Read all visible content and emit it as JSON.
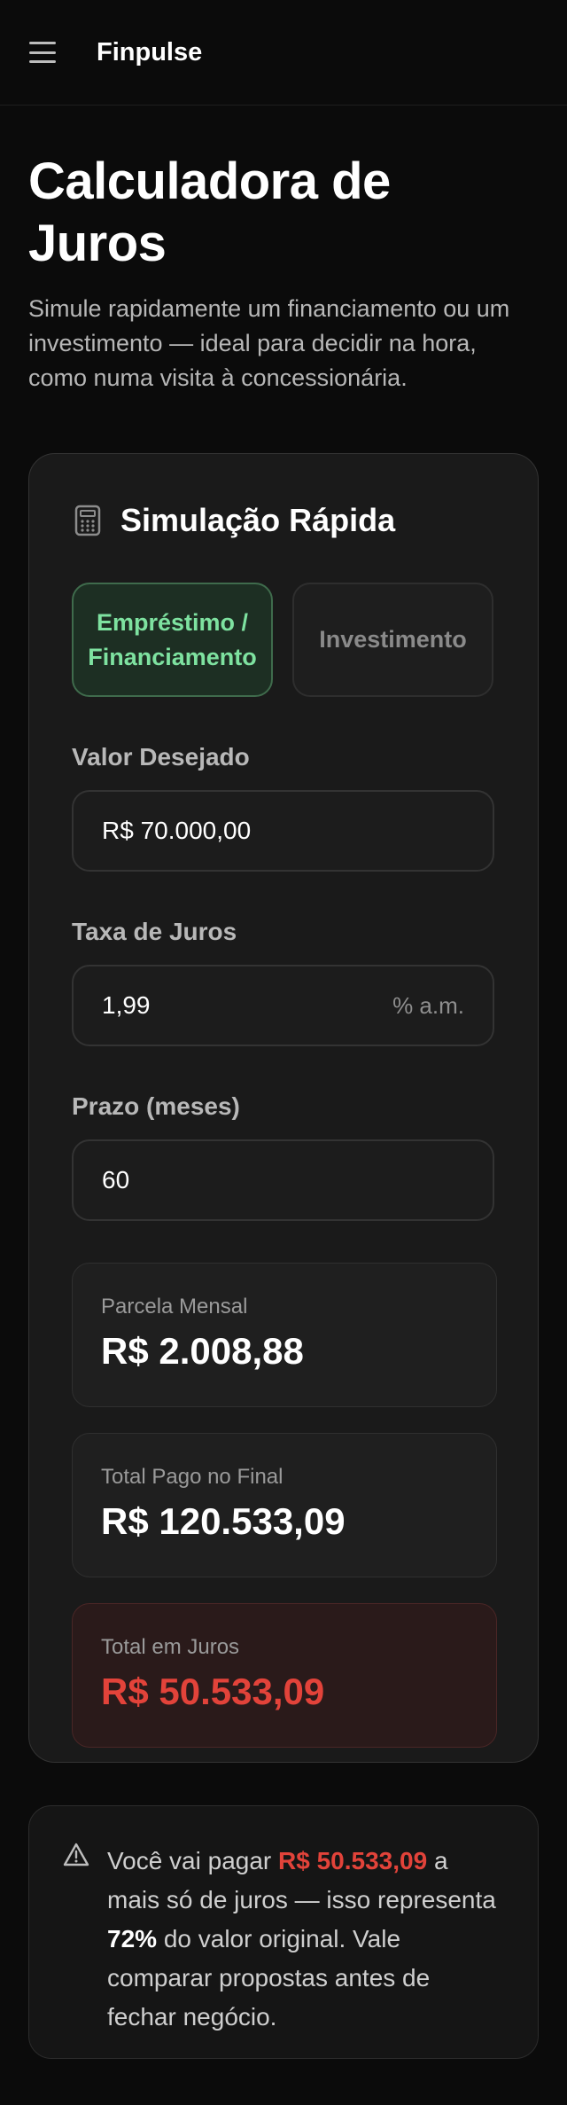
{
  "header": {
    "menu_icon": "hamburger-menu-icon",
    "brand": "Finpulse"
  },
  "page": {
    "title": "Calculadora de Juros",
    "subtitle": "Simule rapidamente um financiamento ou um investimento — ideal para decidir na hora, como numa visita à concessionária."
  },
  "card": {
    "icon": "calculator-icon",
    "title": "Simulação Rápida",
    "tabs": [
      {
        "label": "Empréstimo / Financiamento",
        "active": true
      },
      {
        "label": "Investimento",
        "active": false
      }
    ],
    "fields": {
      "amount": {
        "label": "Valor Desejado",
        "value": "R$ 70.000,00"
      },
      "rate": {
        "label": "Taxa de Juros",
        "value": "1,99",
        "suffix": "% a.m."
      },
      "term": {
        "label": "Prazo (meses)",
        "value": "60"
      }
    },
    "results": {
      "monthly": {
        "label": "Parcela Mensal",
        "value": "R$ 2.008,88"
      },
      "total": {
        "label": "Total Pago no Final",
        "value": "R$ 120.533,09"
      },
      "interest": {
        "label": "Total em Juros",
        "value": "R$ 50.533,09"
      }
    }
  },
  "alert": {
    "icon": "warning-triangle-icon",
    "prefix": "Você vai pagar ",
    "amount": "R$ 50.533,09",
    "middle": " a mais só de juros — isso representa ",
    "percent": "72%",
    "suffix": " do valor original. Vale comparar propostas antes de fechar negócio."
  },
  "colors": {
    "accent_green": "#7ee2a0",
    "danger_red": "#e2433a",
    "background": "#0b0b0b"
  }
}
